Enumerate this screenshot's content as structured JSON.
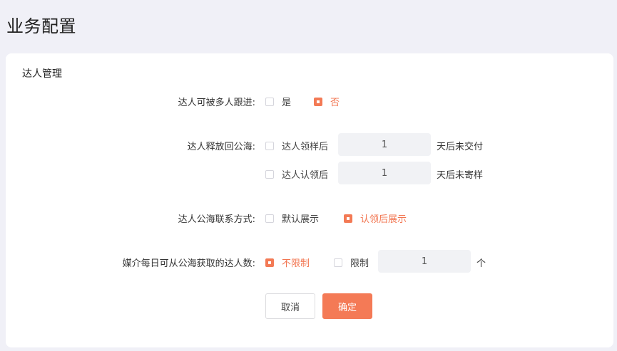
{
  "page": {
    "title": "业务配置"
  },
  "section": {
    "title": "达人管理"
  },
  "rows": {
    "multi_follow": {
      "label": "达人可被多人跟进:",
      "options": [
        {
          "label": "是",
          "checked": false
        },
        {
          "label": "否",
          "checked": true
        }
      ]
    },
    "release": {
      "label": "达人释放回公海:",
      "items": [
        {
          "prefix": "达人领样后",
          "value": "1",
          "suffix": "天后未交付",
          "checked": false
        },
        {
          "prefix": "达人认领后",
          "value": "1",
          "suffix": "天后未寄样",
          "checked": false
        }
      ]
    },
    "contact": {
      "label": "达人公海联系方式:",
      "options": [
        {
          "label": "默认展示",
          "checked": false
        },
        {
          "label": "认领后展示",
          "checked": true
        }
      ]
    },
    "daily_limit": {
      "label": "媒介每日可从公海获取的达人数:",
      "options": [
        {
          "label": "不限制",
          "checked": true
        },
        {
          "label": "限制",
          "checked": false
        }
      ],
      "value": "1",
      "unit": "个"
    }
  },
  "buttons": {
    "cancel": "取消",
    "confirm": "确定"
  },
  "colors": {
    "accent": "#f47a56",
    "background": "#f0f0f7"
  }
}
